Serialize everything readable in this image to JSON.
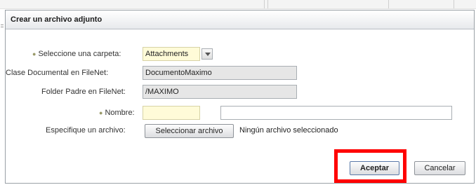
{
  "dialog": {
    "title": "Crear un archivo adjunto"
  },
  "form": {
    "folder": {
      "label": "Seleccione una carpeta:",
      "value": "Attachments",
      "required": true
    },
    "doc_class": {
      "label": "Clase Documental en FileNet:",
      "value": "DocumentoMaximo"
    },
    "parent_folder": {
      "label": "Folder Padre en FileNet:",
      "value": "/MAXIMO"
    },
    "name": {
      "label": "Nombre:",
      "value": "",
      "required": true,
      "extra_value": ""
    },
    "file": {
      "label": "Especifique un archivo:",
      "button_label": "Seleccionar archivo",
      "status": "Ningún archivo seleccionado"
    }
  },
  "buttons": {
    "accept_label": "Aceptar",
    "cancel_label": "Cancelar"
  },
  "colors": {
    "highlight": "#ff0000",
    "required_field_bg": "#fffbd8",
    "readonly_field_bg": "#e6e6e6"
  }
}
